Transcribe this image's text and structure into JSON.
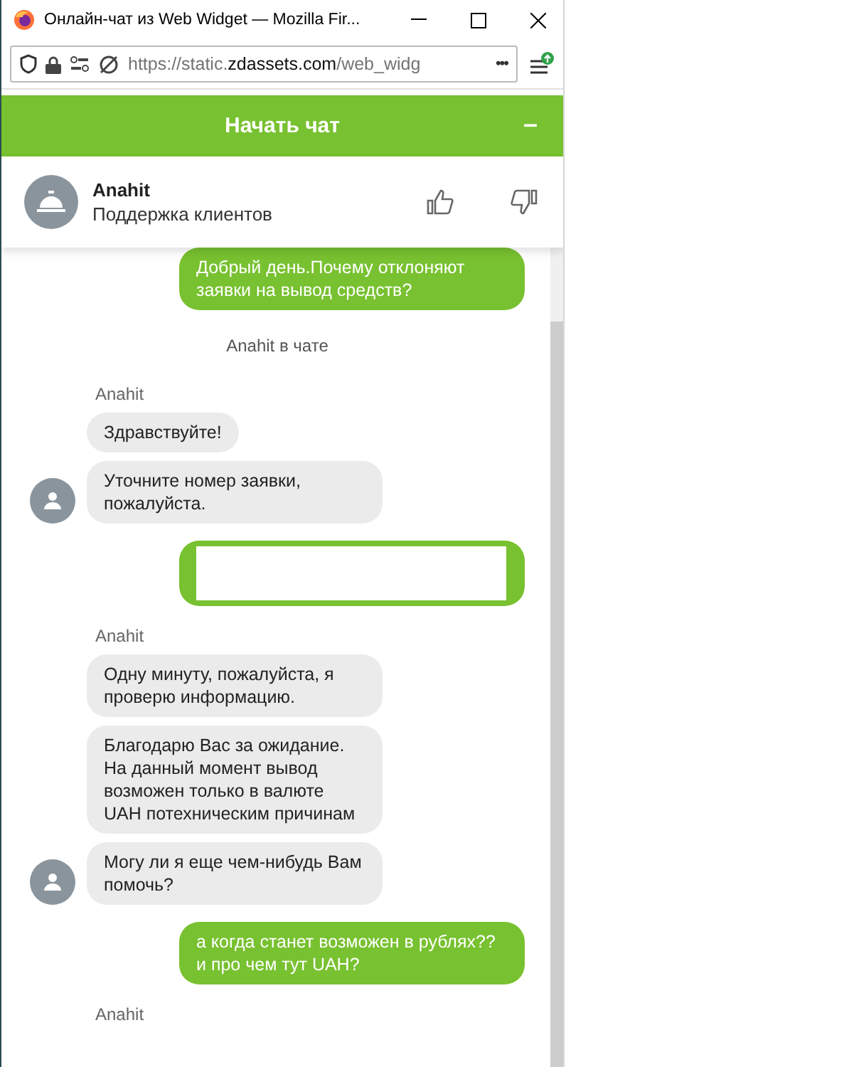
{
  "window": {
    "title": "Онлайн-чат из Web Widget — Mozilla Fir..."
  },
  "address_bar": {
    "url_prefix": "https://static.",
    "url_domain": "zdassets.com",
    "url_rest": "/web_widg",
    "more": "•••"
  },
  "widget_header": {
    "title": "Начать чат",
    "minimize": "–"
  },
  "agent": {
    "name": "Anahit",
    "role": "Поддержка клиентов"
  },
  "messages": [
    {
      "kind": "visitor",
      "text": "Добрый день.Почему отклоняют заявки на вывод средств?"
    },
    {
      "kind": "status",
      "text": "Anahit в чате"
    },
    {
      "kind": "sender",
      "text": "Anahit"
    },
    {
      "kind": "agent",
      "text": "Здравствуйте!",
      "avatar": false
    },
    {
      "kind": "agent",
      "text": "Уточните номер заявки, пожалуйста.",
      "avatar": true
    },
    {
      "kind": "redacted"
    },
    {
      "kind": "sender",
      "text": "Anahit"
    },
    {
      "kind": "agent",
      "text": "Одну минуту, пожалуйста, я проверю информацию.",
      "avatar": false
    },
    {
      "kind": "agent",
      "text": "Благодарю Вас за ожидание. На данный момент вывод возможен только в валюте UAH потехническим причинам",
      "avatar": false
    },
    {
      "kind": "agent",
      "text": "Могу ли я еще чем-нибудь Вам помочь?",
      "avatar": true
    },
    {
      "kind": "visitor",
      "text": "а когда станет возможен в рублях?? и про чем тут UAH?"
    },
    {
      "kind": "sender",
      "text": "Anahit"
    }
  ]
}
